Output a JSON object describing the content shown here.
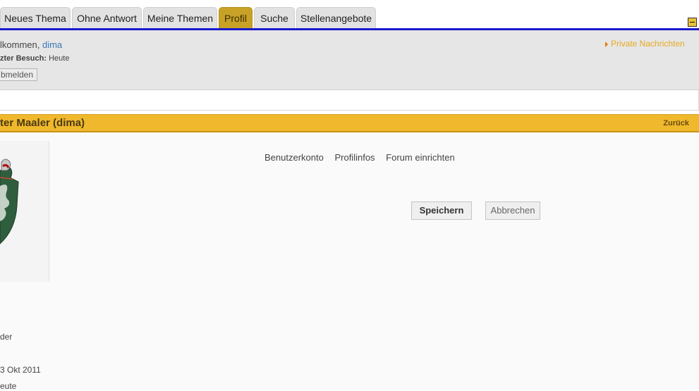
{
  "tabs": [
    {
      "label": "Neues Thema",
      "active": false
    },
    {
      "label": "Ohne Antwort",
      "active": false
    },
    {
      "label": "Meine Themen",
      "active": false
    },
    {
      "label": "Profil",
      "active": true
    },
    {
      "label": "Suche",
      "active": false
    },
    {
      "label": "Stellenangebote",
      "active": false
    }
  ],
  "welcome": {
    "greeting": "lkommen, ",
    "username": "dima",
    "last_visit_label": "zter Besuch:",
    "last_visit_value": "Heute",
    "logout_label": "bmelden",
    "private_messages": "Private Nachrichten"
  },
  "profile": {
    "title": "ter Maaler (dima)",
    "back_label": "Zurück",
    "subnav": [
      "Benutzerkonto",
      "Profilinfos",
      "Forum einrichten"
    ],
    "save_label": "Speichern",
    "cancel_label": "Abbrechen",
    "info_lines": [
      "der",
      "3 Okt 2011",
      "eute"
    ]
  },
  "colors": {
    "accent_bar": "#f0b82c",
    "active_tab": "#c8a127",
    "top_line": "#1a1ad0",
    "link": "#3b78b8",
    "pm_link": "#e7a91e"
  }
}
